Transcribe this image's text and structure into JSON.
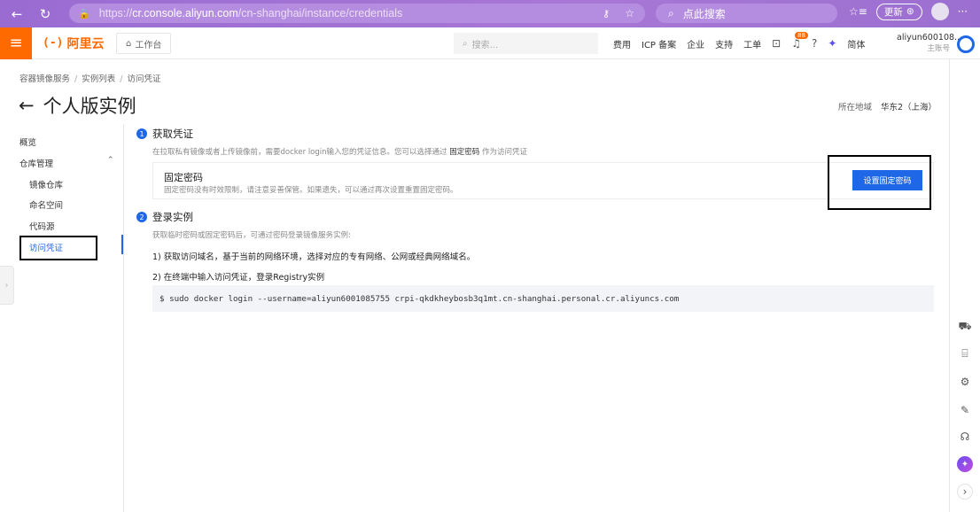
{
  "browser": {
    "url_prefix": "https://",
    "url_host": "cr.console.aliyun.com",
    "url_path": "/cn-shanghai/instance/credentials",
    "search_placeholder": "点此搜索",
    "update_label": "更新"
  },
  "topbar": {
    "logo_mark": "(-)",
    "logo_text": "阿里云",
    "workbench": "工作台",
    "search_placeholder": "搜索...",
    "links": [
      "费用",
      "ICP 备案",
      "企业",
      "支持",
      "工单"
    ],
    "notification_count": "88",
    "language": "简体",
    "account_name": "aliyun600108...",
    "account_role": "主账号"
  },
  "breadcrumb": [
    "容器镜像服务",
    "实例列表",
    "访问凭证"
  ],
  "page": {
    "back_arrow": "←",
    "title": "个人版实例",
    "region_label": "所在地域",
    "region_value": "华东2（上海）"
  },
  "sidebar": {
    "overview": "概览",
    "repo_mgmt": "仓库管理",
    "items": [
      "镜像仓库",
      "命名空间",
      "代码源",
      "访问凭证"
    ]
  },
  "step1": {
    "num": "1",
    "title": "获取凭证",
    "desc_pre": "在拉取私有镜像或者上传镜像前，需要docker login输入您的凭证信息。您可以选择通过 ",
    "desc_bold": "固定密码",
    "desc_post": " 作为访问凭证",
    "card_title": "固定密码",
    "card_desc": "固定密码没有时效限制，请注意妥善保管。如果遗失，可以通过再次设置重置固定密码。",
    "button": "设置固定密码"
  },
  "step2": {
    "num": "2",
    "title": "登录实例",
    "desc": "获取临时密码或固定密码后，可通过密码登录镜像服务实例:",
    "line1": "1) 获取访问域名，基于当前的网络环境，选择对应的专有网络、公网或经典网络域名。",
    "line2": "2) 在终端中输入访问凭证，登录Registry实例",
    "command": "$ sudo docker login --username=aliyun6001085755 crpi-qkdkheybosb3q1mt.cn-shanghai.personal.cr.aliyuncs.com"
  },
  "colors": {
    "brand_orange": "#ff6a00",
    "primary_blue": "#1e68e8",
    "browser_purple": "#9b6fd0"
  },
  "icons": {
    "rail": [
      "cart-icon",
      "chip-icon",
      "settings-icon",
      "edit-icon",
      "headset-icon",
      "ai-assistant-icon",
      "expand-icon"
    ]
  }
}
